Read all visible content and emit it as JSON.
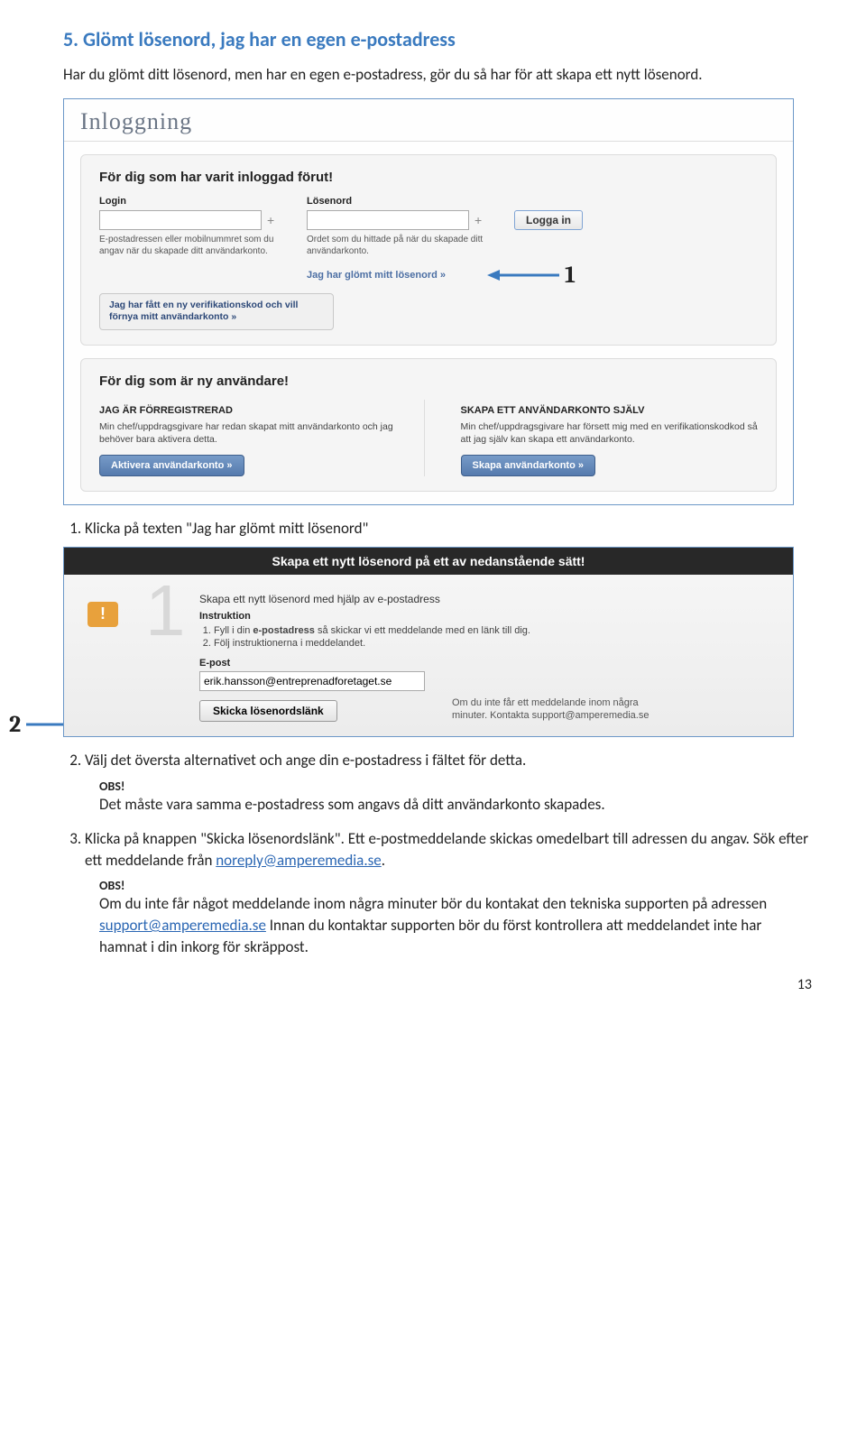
{
  "heading": "5. Glömt lösenord, jag har en egen e-postadress",
  "intro": "Har du glömt ditt lösenord, men har en egen e-postadress, gör du så har för att skapa ett nytt lösenord.",
  "annot1": "1",
  "annot2": "2",
  "shot1": {
    "title": "Inloggning",
    "sectionA": "För dig som har varit inloggad förut!",
    "login_label": "Login",
    "login_hint": "E-postadressen eller mobilnummret som du angav när du skapade ditt användarkonto.",
    "pw_label": "Lösenord",
    "pw_hint": "Ordet som du hittade på när du skapade ditt användarkonto.",
    "login_btn": "Logga in",
    "forgot": "Jag har glömt mitt lösenord »",
    "verify": "Jag har fått en ny verifikationskod och vill förnya mitt användarkonto »",
    "sectionB": "För dig som är ny användare!",
    "colA_title": "JAG ÄR FÖRREGISTRERAD",
    "colA_text": "Min chef/uppdragsgivare har redan skapat mitt användarkonto och jag behöver bara aktivera detta.",
    "colA_btn": "Aktivera användarkonto »",
    "colB_title": "SKAPA ETT ANVÄNDARKONTO SJÄLV",
    "colB_text": "Min chef/uppdragsgivare har försett mig med en verifikationskodkod så att jag själv kan skapa ett användarkonto.",
    "colB_btn": "Skapa användarkonto »"
  },
  "step1": "Klicka på texten \"Jag har glömt mitt lösenord\"",
  "shot2": {
    "bar": "Skapa ett nytt lösenord på ett av nedanstående sätt!",
    "method": "Skapa ett nytt lösenord med hjälp av e-postadress",
    "instr_label": "Instruktion",
    "instr1": "Fyll i din e-postadress så skickar vi ett meddelande med en länk till dig.",
    "instr2": "Följ instruktionerna i meddelandet.",
    "epost_label": "E-post",
    "epost_value": "erik.hansson@entreprenadforetaget.se",
    "help": "Om du inte får ett meddelande inom några minuter. Kontakta support@amperemedia.se",
    "btn": "Skicka lösenordslänk"
  },
  "step2": "Välj det översta alternativet och ange din e-postadress i fältet för detta.",
  "obs": "OBS!",
  "obs1": "Det måste vara samma e-postadress som angavs då ditt användarkonto skapades.",
  "step3a": "Klicka på knappen \"Skicka lösenordslänk\". Ett e-postmeddelande skickas omedelbart till adressen du angav. Sök efter ett meddelande från ",
  "step3_link": "noreply@amperemedia.se",
  "step3b": ".",
  "obs2a": "Om du inte får något meddelande inom några minuter bör du kontakat den tekniska supporten på adressen ",
  "obs2_link": "support@amperemedia.se",
  "obs2b": " Innan du kontaktar supporten bör du först kontrollera att meddelandet inte har hamnat i din inkorg för skräppost.",
  "pageno": "13"
}
